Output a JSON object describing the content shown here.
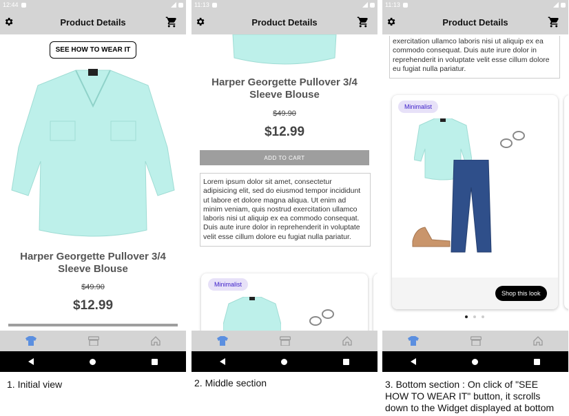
{
  "phones": [
    {
      "time": "12:44",
      "title": "Product Details"
    },
    {
      "time": "11:13",
      "title": "Product Details"
    },
    {
      "time": "11:13",
      "title": "Product Details"
    }
  ],
  "product": {
    "wear_button": "SEE HOW TO WEAR IT",
    "name_line1": "Harper Georgette Pullover 3/4",
    "name_line2": "Sleeve Blouse",
    "old_price": "$49.90",
    "price": "$12.99",
    "add_to_cart": "ADD TO CART",
    "description": "Lorem ipsum dolor sit amet, consectetur adipisicing elit, sed do eiusmod tempor incididunt ut labore et dolore magna aliqua. Ut enim ad minim veniam, quis nostrud exercitation ullamco laboris nisi ut aliquip ex ea commodo consequat. Duis aute irure dolor in reprehenderit in voluptate velit esse cillum dolore eu fugiat nulla pariatur.",
    "description_tail": "exercitation ullamco laboris nisi ut aliquip ex ea commodo consequat. Duis aute irure dolor in reprehenderit in voluptate velit esse cillum dolore eu fugiat nulla pariatur."
  },
  "widget": {
    "badge": "Minimalist",
    "shop_button": "Shop this look"
  },
  "captions": {
    "c1": "1. Initial view",
    "c2": "2. Middle section",
    "c3_line1": "3. Bottom section : On click of \"SEE",
    "c3_line2": "HOW TO WEAR IT\"  button, it scrolls",
    "c3_line3": "down to the Widget displayed at bottom"
  },
  "icons": {
    "nav1": "shirt-icon",
    "nav2": "store-icon",
    "nav3": "home-icon"
  },
  "colors": {
    "bar": "#d4d4d4",
    "shirt": "#bdf0ea",
    "badge_text": "#3a1cc8",
    "nav_active": "#5b8fe0"
  }
}
